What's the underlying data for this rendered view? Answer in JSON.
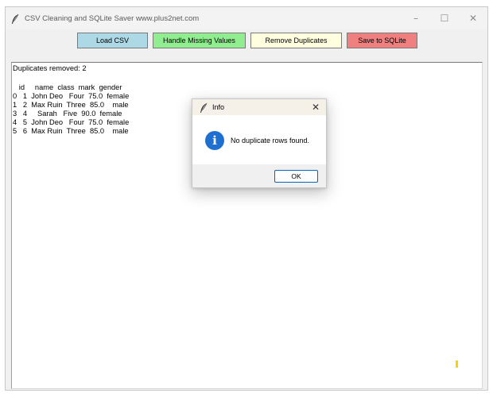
{
  "window": {
    "title": "CSV Cleaning and SQLite Saver www.plus2net.com",
    "controls": {
      "minimize": "–",
      "maximize": "☐",
      "close": "✕"
    }
  },
  "toolbar": {
    "load_csv": "Load CSV",
    "handle_missing": "Handle Missing Values",
    "remove_duplicates": "Remove Duplicates",
    "save_sqlite": "Save to SQLite"
  },
  "colors": {
    "load_csv": "#add8e6",
    "handle_missing": "#90ee90",
    "remove_duplicates": "#ffffe0",
    "save_sqlite": "#f08080"
  },
  "output": {
    "status": "Duplicates removed: 2",
    "table_header": "   id     name  class  mark  gender",
    "rows": [
      "0   1  John Deo   Four  75.0  female",
      "1   2  Max Ruin  Three  85.0    male",
      "3   4     Sarah   Five  90.0  female",
      "4   5  John Deo   Four  75.0  female",
      "5   6  Max Ruin  Three  85.0    male"
    ]
  },
  "dialog": {
    "title": "Info",
    "close": "✕",
    "icon": "info-icon",
    "message": "No duplicate rows found.",
    "ok": "OK"
  }
}
